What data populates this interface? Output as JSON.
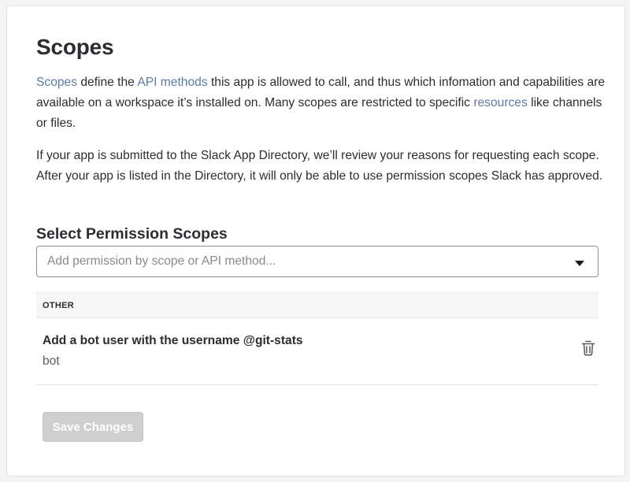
{
  "page": {
    "title": "Scopes"
  },
  "intro": {
    "scopes_link": "Scopes",
    "text1": " define the ",
    "api_methods_link": "API methods",
    "text2": " this app is allowed to call, and thus which infomation and capabilities are available on a workspace it’s installed on. Many scopes are restricted to specific ",
    "resources_link": "resources",
    "text3": " like channels or files."
  },
  "review_note": "If your app is submitted to the Slack App Directory, we’ll review your reasons for requesting each scope. After your app is listed in the Directory, it will only be able to use permission scopes Slack has approved.",
  "permission_section": {
    "title": "Select Permission Scopes",
    "select_placeholder": "Add permission by scope or API method...",
    "groups": [
      {
        "label": "OTHER",
        "items": [
          {
            "title": "Add a bot user with the username @git-stats",
            "scope": "bot"
          }
        ]
      }
    ]
  },
  "actions": {
    "save_label": "Save Changes"
  },
  "icons": {
    "dropdown": "caret-down-icon",
    "delete": "trash-icon"
  },
  "colors": {
    "link": "#5a7ca6",
    "disabled_button": "#cfcfd0"
  }
}
